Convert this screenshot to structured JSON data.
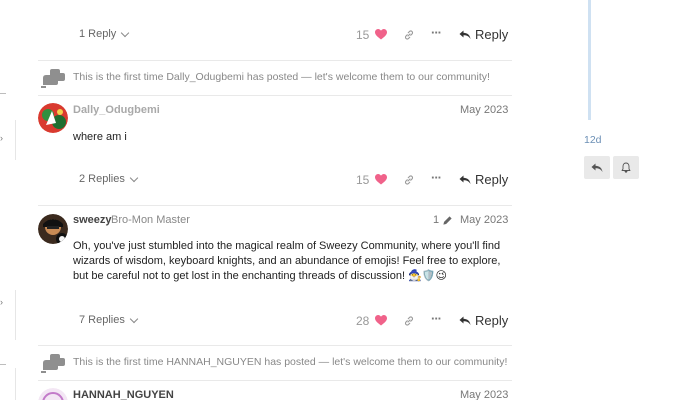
{
  "posts": [
    {
      "replies_label": "1 Reply",
      "like_count": "15",
      "reply_label": "Reply"
    },
    {
      "username": "Dally_Odugbemi",
      "date": "May 2023",
      "body": "where am i",
      "replies_label": "2 Replies",
      "like_count": "15",
      "reply_label": "Reply"
    },
    {
      "username": "sweezy",
      "user_title": "Bro-Mon Master",
      "edit_count": "1",
      "date": "May 2023",
      "body": "Oh, you've just stumbled into the magical realm of Sweezy Community, where you'll find wizards of wisdom, keyboard knights, and an abundance of emojis! Feel free to explore, but be careful not to get lost in the enchanting threads of discussion! 🧙‍♂️🛡️😉",
      "replies_label": "7 Replies",
      "like_count": "28",
      "reply_label": "Reply"
    },
    {
      "username": "HANNAH_NGUYEN",
      "date": "May 2023"
    }
  ],
  "small_actions": [
    {
      "text": "This is the first time Dally_Odugbemi has posted — let's welcome them to our community!"
    },
    {
      "text": "This is the first time HANNAH_NGUYEN has posted — let's welcome them to our community!"
    }
  ],
  "timeline": {
    "date": "12d"
  },
  "icons": {
    "heart": "heart-icon",
    "link": "link-icon",
    "more": "ellipsis-icon",
    "reply": "reply-arrow-icon",
    "wave": "waving-hand-icon",
    "bell": "bell-icon",
    "edit": "pencil-icon"
  },
  "colors": {
    "heart": "#f0628a",
    "timeline": "#cfe1f2",
    "timeline_date": "#6b8fb5"
  }
}
